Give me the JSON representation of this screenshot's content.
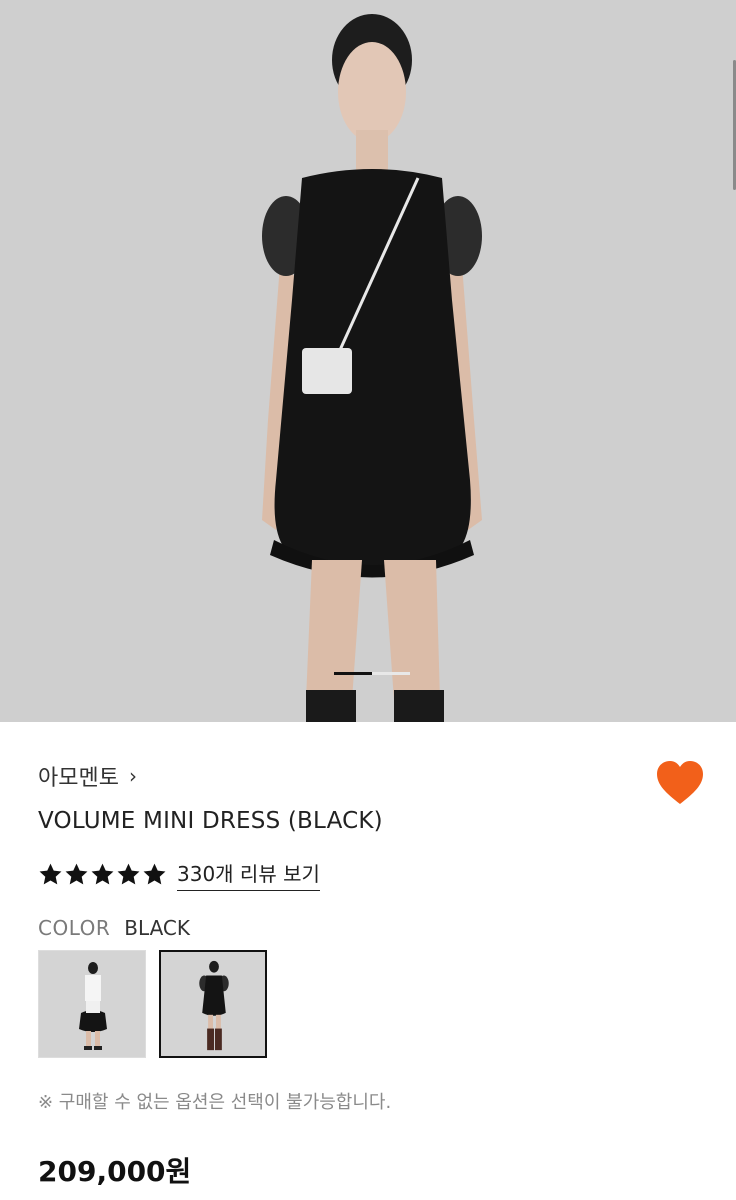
{
  "product": {
    "brand": "아모멘토",
    "brand_chevron": "›",
    "title": "VOLUME MINI DRESS (BLACK)",
    "rating": 5,
    "review_link": "330개 리뷰 보기",
    "price": "209,000원"
  },
  "color": {
    "label": "COLOR",
    "selected": "BLACK"
  },
  "notice": "※ 구매할 수 없는 옵션은 선택이 불가능합니다.",
  "carousel": {
    "current_page": 1
  },
  "colors": {
    "like": "#f2601a",
    "hero_bg": "#cfcfcf"
  },
  "icons": {
    "like": "heart-icon",
    "star": "star-icon",
    "chevron": "chevron-right-icon"
  }
}
